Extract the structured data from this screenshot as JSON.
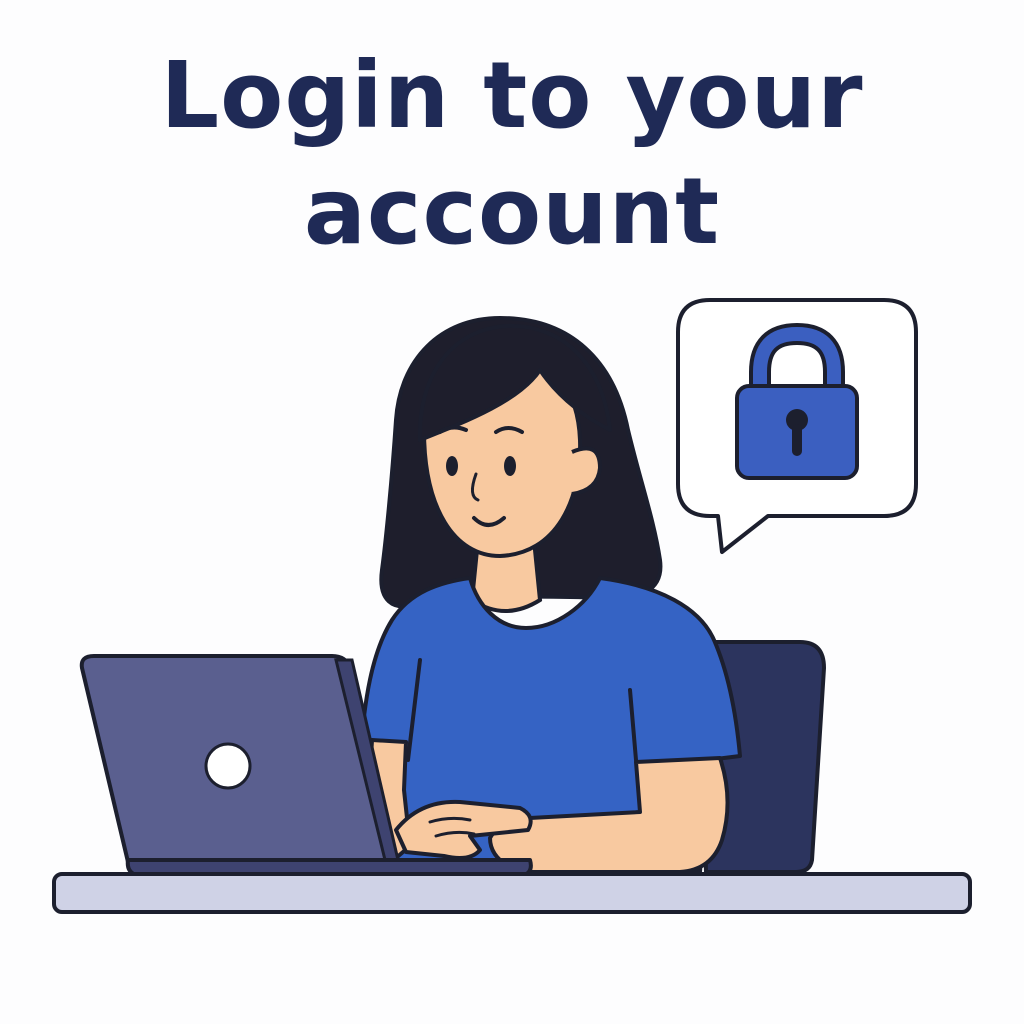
{
  "headline": {
    "line1": "Login to your",
    "line2": "account"
  },
  "icons": {
    "speech_bubble": "speech-bubble-icon",
    "lock": "padlock-icon",
    "laptop_logo": "laptop-logo-icon"
  },
  "colors": {
    "title": "#1f2a56",
    "outline": "#1c1f2e",
    "shirt": "#3563c4",
    "skin": "#f8c9a0",
    "hair": "#1e1e2c",
    "laptop": "#5a5f8f",
    "chair": "#2c345e",
    "desk": "#cfd2e6",
    "lock": "#3b5fc0",
    "background": "#fdfdfe"
  }
}
